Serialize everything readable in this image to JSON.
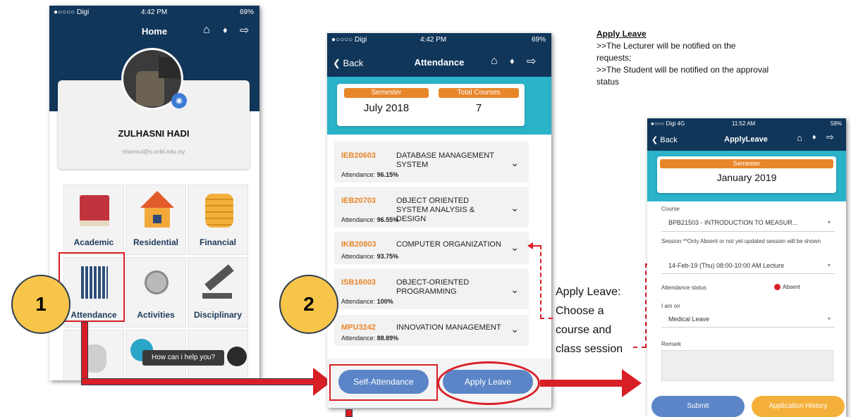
{
  "phone1": {
    "status": {
      "carrier": "●○○○○ Digi",
      "time": "4:42 PM",
      "battery": "69%"
    },
    "title": "Home",
    "profile": {
      "name": "ZULHASNI HADI",
      "email": "shamsul@s.unikl.edu.my"
    },
    "tiles": [
      {
        "label": "Academic",
        "icon": "book-icon"
      },
      {
        "label": "Residential",
        "icon": "house-icon"
      },
      {
        "label": "Financial",
        "icon": "coins-icon"
      },
      {
        "label": "Attendance",
        "icon": "qr-code-icon"
      },
      {
        "label": "Activities",
        "icon": "medal-icon"
      },
      {
        "label": "Disciplinary",
        "icon": "gavel-icon"
      }
    ],
    "chat_prompt": "How can i help you?"
  },
  "phone2": {
    "status": {
      "carrier": "●○○○○ Digi",
      "time": "4:42 PM",
      "battery": "69%"
    },
    "back": "Back",
    "title": "Attendance",
    "semester_label": "Semester",
    "semester_value": "July 2018",
    "total_label": "Total Courses",
    "total_value": "7",
    "courses": [
      {
        "code": "IEB20603",
        "name": "DATABASE MANAGEMENT SYSTEM",
        "att_label": "Attendance:",
        "att": "96.15%"
      },
      {
        "code": "IEB20703",
        "name": "OBJECT ORIENTED SYSTEM ANALYSIS & DESIGN",
        "att_label": "Attendance:",
        "att": "96.55%"
      },
      {
        "code": "IKB20803",
        "name": "COMPUTER ORGANIZATION",
        "att_label": "Attendance:",
        "att": "93.75%"
      },
      {
        "code": "ISB16003",
        "name": "OBJECT-ORIENTED PROGRAMMING",
        "att_label": "Attendance:",
        "att": "100%"
      },
      {
        "code": "MPU3242",
        "name": "INNOVATION MANAGEMENT",
        "att_label": "Attendance:",
        "att": "88.89%"
      }
    ],
    "self_attendance": "Self-Attendance",
    "apply_leave": "Apply Leave"
  },
  "phone3": {
    "status": {
      "carrier": "●○○○ Digi 4G",
      "time": "11:52 AM",
      "battery": "59%"
    },
    "back": "Back",
    "title": "ApplyLeave",
    "semester_label": "Semester",
    "semester_value": "January 2019",
    "course_label": "Course",
    "course_value": "BPB21503 - INTRODUCTION TO MEASUR...",
    "session_label": "Session **Only Absent or not yet updated session will be shown",
    "session_value": "14-Feb-19 (Thu) 08:00-10:00 AM Lecture",
    "status_label": "Attendance status",
    "status_value": "Absent",
    "iam_label": "I am on",
    "iam_value": "Medical Leave",
    "remark_label": "Remark",
    "submit": "Submit",
    "history": "Application History"
  },
  "annotations": {
    "step1": "1",
    "step2": "2",
    "apply_title": "Apply Leave",
    "apply_line1": ">>The Lecturer will be notified on the requests;",
    "apply_line2": ">>The Student will be notified on the approval status",
    "choose_line1": "Apply Leave:",
    "choose_line2": "Choose a",
    "choose_line3": "course and",
    "choose_line4": "class session"
  },
  "colors": {
    "navy": "#10365a",
    "teal": "#2ab3c9",
    "orange": "#e8862a",
    "blue_button": "#5b85c7",
    "orange_button": "#f4b03a",
    "annotation_red": "#d91f26",
    "step_circle": "#f7c54a"
  }
}
